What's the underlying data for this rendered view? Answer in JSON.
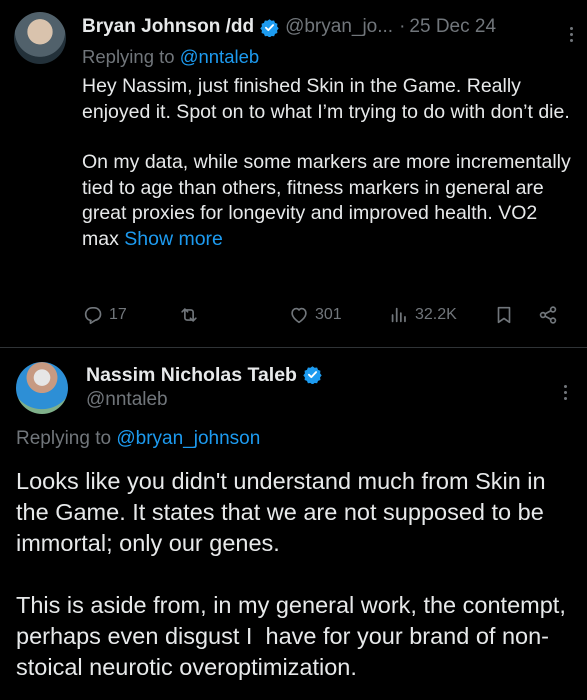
{
  "tweet1": {
    "display_name": "Bryan Johnson /dd",
    "handle": "@bryan_jo...",
    "separator": "·",
    "date": "25 Dec 24",
    "replying_prefix": "Replying to ",
    "replying_to": "@nntaleb",
    "paragraph1": "Hey Nassim, just finished Skin in the Game. Really enjoyed it. Spot on to what I’m trying to do with don’t die.",
    "paragraph2": "On my data, while some markers are more incrementally tied to age than others, fitness markers in general are great proxies for longevity and improved health. VO2 max ",
    "show_more": "Show more",
    "replies": "17",
    "likes": "301",
    "views": "32.2K"
  },
  "tweet2": {
    "display_name": "Nassim Nicholas Taleb",
    "handle": "@nntaleb",
    "replying_prefix": "Replying to ",
    "replying_to": "@bryan_johnson",
    "paragraph1": "Looks like you didn't understand much from Skin in the Game. It states that we are not supposed to be immortal; only our genes.",
    "paragraph2": "This is aside from, in my general work, the contempt, perhaps even disgust I  have for your brand of non-stoical neurotic overoptimization."
  },
  "colors": {
    "background": "#000000",
    "text": "#e7e9ea",
    "secondary": "#71767b",
    "accent": "#1d9bf0",
    "divider": "#2f3336"
  },
  "icons": [
    "reply-icon",
    "retweet-icon",
    "like-icon",
    "views-icon",
    "bookmark-icon",
    "share-icon",
    "verified-icon",
    "more-icon"
  ]
}
